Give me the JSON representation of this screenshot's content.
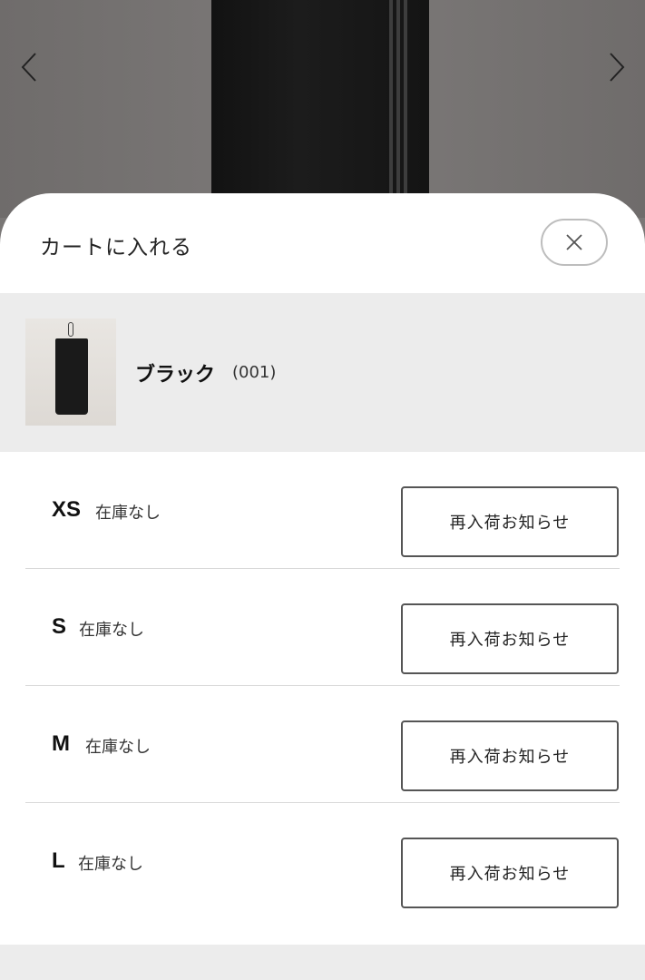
{
  "sheet": {
    "title": "カートに入れる"
  },
  "variant": {
    "name": "ブラック",
    "code": "(001)"
  },
  "sizes": [
    {
      "label": "XS",
      "stock": "在庫なし",
      "action": "再入荷お知らせ"
    },
    {
      "label": "S",
      "stock": "在庫なし",
      "action": "再入荷お知らせ"
    },
    {
      "label": "M",
      "stock": "在庫なし",
      "action": "再入荷お知らせ"
    },
    {
      "label": "L",
      "stock": "在庫なし",
      "action": "再入荷お知らせ"
    }
  ],
  "icons": {
    "prev": "chevron-left-icon",
    "next": "chevron-right-icon",
    "close": "close-icon"
  }
}
